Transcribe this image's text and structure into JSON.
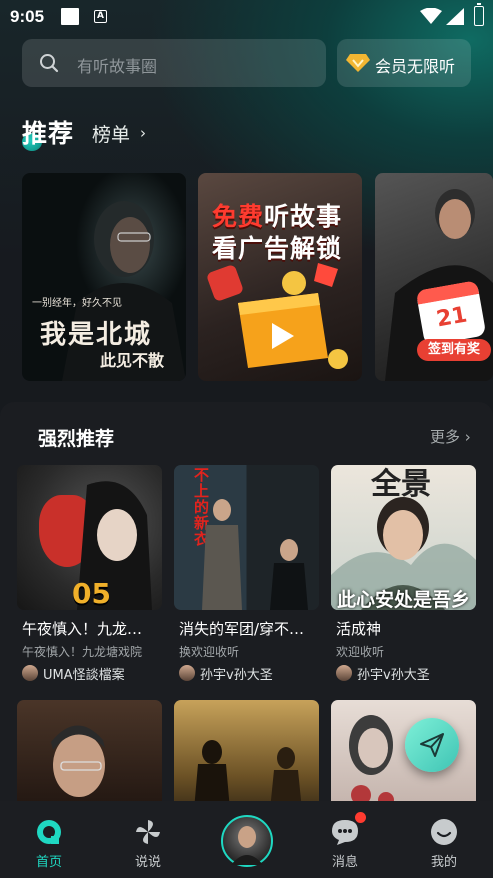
{
  "status_bar": {
    "time": "9:05",
    "accessibility_glyph": "A"
  },
  "search": {
    "placeholder": "有听故事圈",
    "icon": "search-icon"
  },
  "vip": {
    "label": "会员无限听",
    "icon": "diamond-icon",
    "accent": "#f2b632"
  },
  "tabs": {
    "active": "推荐",
    "second": "榜单",
    "chevron": "›"
  },
  "banners": [
    {
      "line1": "一别经年，好久不见",
      "line2": "我是北城",
      "line3": "此见不散"
    },
    {
      "free": "免费",
      "rest1": "听故事",
      "line2": "看广告解锁"
    },
    {
      "calendar_day": "21",
      "badge": "签到有奖"
    }
  ],
  "section": {
    "title": "强烈推荐",
    "more": "更多 ›"
  },
  "cards": [
    {
      "title": "午夜慎入！九龙…",
      "subtitle": "午夜慎入！九龙塘戏院",
      "author": "UMA怪談檔案",
      "cover_text": "05"
    },
    {
      "title": "消失的军团/穿不…",
      "subtitle": "换欢迎收听",
      "author": "孙宇v孙大圣",
      "cover_text": "不上的新衣"
    },
    {
      "title": "活成神",
      "subtitle": "欢迎收听",
      "author": "孙宇v孙大圣",
      "cover_text_top": "全景",
      "cover_text_bottom": "此心安处是吾乡"
    }
  ],
  "nav": [
    {
      "label": "首页",
      "icon": "home-icon",
      "active": true
    },
    {
      "label": "说说",
      "icon": "pinwheel-icon",
      "active": false
    },
    {
      "label": "",
      "icon": "avatar",
      "active": false
    },
    {
      "label": "消息",
      "icon": "chat-icon",
      "active": false
    },
    {
      "label": "我的",
      "icon": "profile-icon",
      "active": false
    }
  ],
  "colors": {
    "accent": "#1fd8c2",
    "badge_red": "#e84033",
    "background": "#17191d"
  }
}
